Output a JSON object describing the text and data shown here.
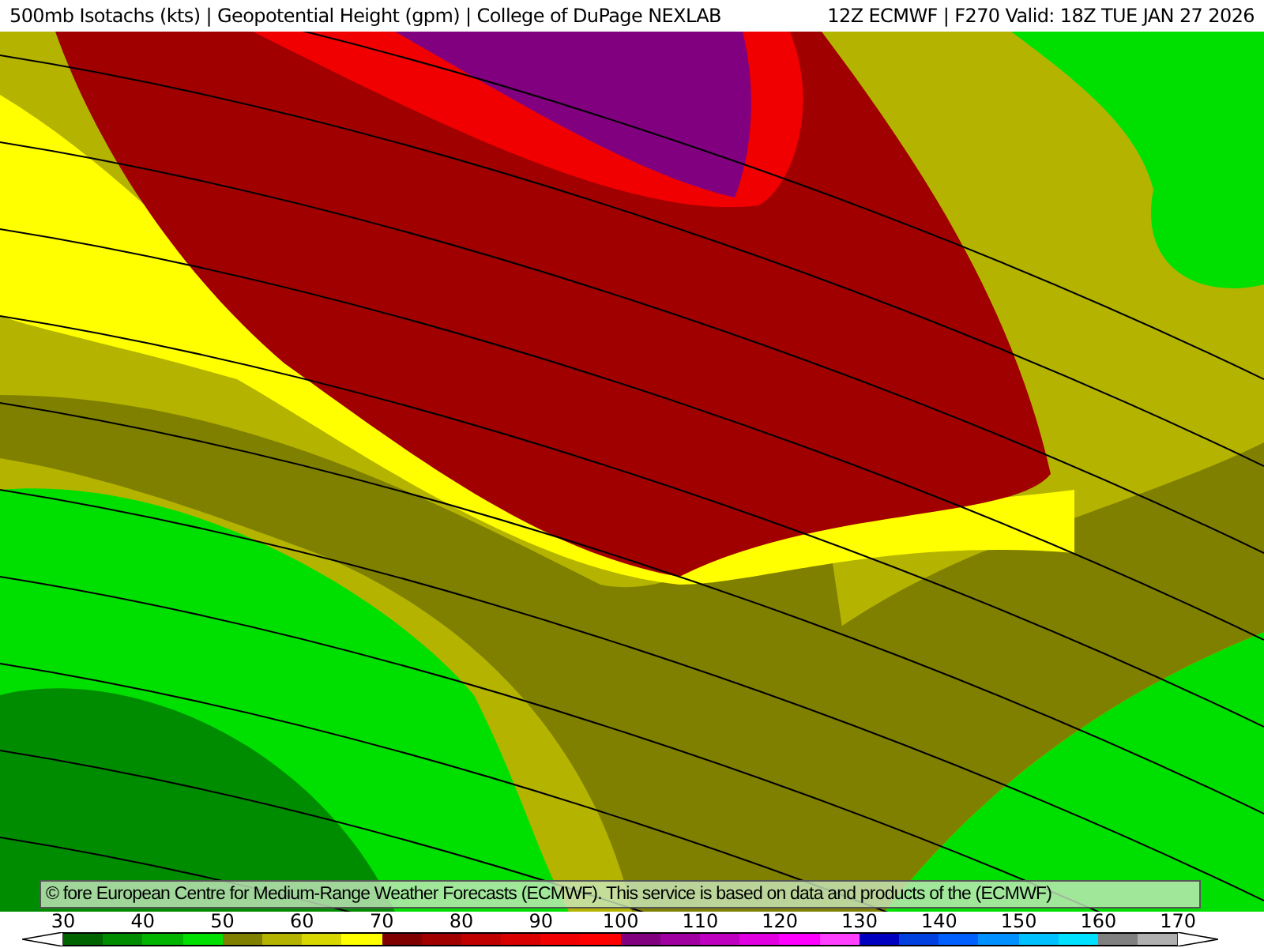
{
  "title": {
    "left": "500mb Isotachs (kts) | Geopotential Height (gpm) | College of DuPage NEXLAB",
    "right": "12Z ECMWF | F270 Valid: 18Z TUE JAN 27 2026"
  },
  "credit": "© fore European Centre for Medium-Range Weather Forecasts (ECMWF). This service is based on data and products of the (ECMWF)",
  "legend": {
    "labels": [
      "30",
      "40",
      "50",
      "60",
      "70",
      "80",
      "90",
      "100",
      "110",
      "120",
      "130",
      "140",
      "150",
      "160",
      "170"
    ],
    "swatches": [
      {
        "color": "#006400"
      },
      {
        "color": "#008c00"
      },
      {
        "color": "#00b400"
      },
      {
        "color": "#00e000"
      },
      {
        "color": "#808000"
      },
      {
        "color": "#b4b400"
      },
      {
        "color": "#d8d800"
      },
      {
        "color": "#ffff00"
      },
      {
        "color": "#800000"
      },
      {
        "color": "#a00000"
      },
      {
        "color": "#c00000"
      },
      {
        "color": "#d80000"
      },
      {
        "color": "#f00000"
      },
      {
        "color": "#ff0000"
      },
      {
        "color": "#800080"
      },
      {
        "color": "#a000a0"
      },
      {
        "color": "#c000c0"
      },
      {
        "color": "#e000e0"
      },
      {
        "color": "#ff00ff"
      },
      {
        "color": "#ff40ff"
      },
      {
        "color": "#0000c0"
      },
      {
        "color": "#0040e0"
      },
      {
        "color": "#0060ff"
      },
      {
        "color": "#0090ff"
      },
      {
        "color": "#00c0ff"
      },
      {
        "color": "#00e0ff"
      },
      {
        "color": "#808080"
      },
      {
        "color": "#b0b0b0"
      }
    ]
  }
}
